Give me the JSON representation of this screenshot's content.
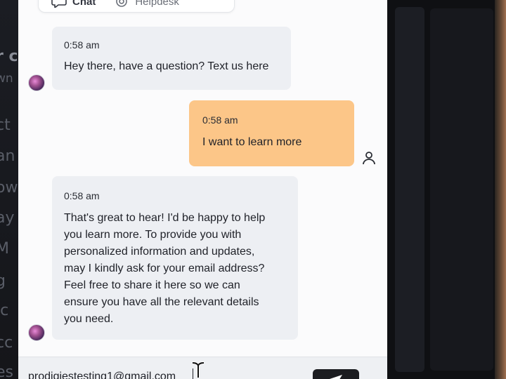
{
  "background": {
    "left_fragments": [
      "r c",
      "wn",
      "ct",
      "an",
      "ow",
      "ay",
      "M",
      "g",
      "lc",
      "cc",
      "es"
    ]
  },
  "chat": {
    "tabs": [
      {
        "label": "Chat",
        "icon": "chat-bubble-icon",
        "active": true
      },
      {
        "label": "Helpdesk",
        "icon": "helpdesk-icon",
        "active": false
      }
    ],
    "messages": [
      {
        "sender": "bot",
        "time": "0:58 am",
        "text": "Hey there, have a question? Text us here"
      },
      {
        "sender": "user",
        "time": "0:58 am",
        "text": "I want to learn more"
      },
      {
        "sender": "bot",
        "time": "0:58 am",
        "text": "That's great to hear! I'd be happy to help\nyou learn more. To provide you with\npersonalized information and updates,\nmay I kindly ask for your email address?\nFeel free to share it here so we can\nensure you have all the relevant details\nyou need."
      }
    ],
    "input": {
      "value": "prodigiestesting1@gmail.com"
    },
    "send_icon": "send-arrow-icon"
  },
  "colors": {
    "user_bubble": "#fcc688",
    "bot_bubble": "#edeff3",
    "send_button": "#1b1c20"
  }
}
